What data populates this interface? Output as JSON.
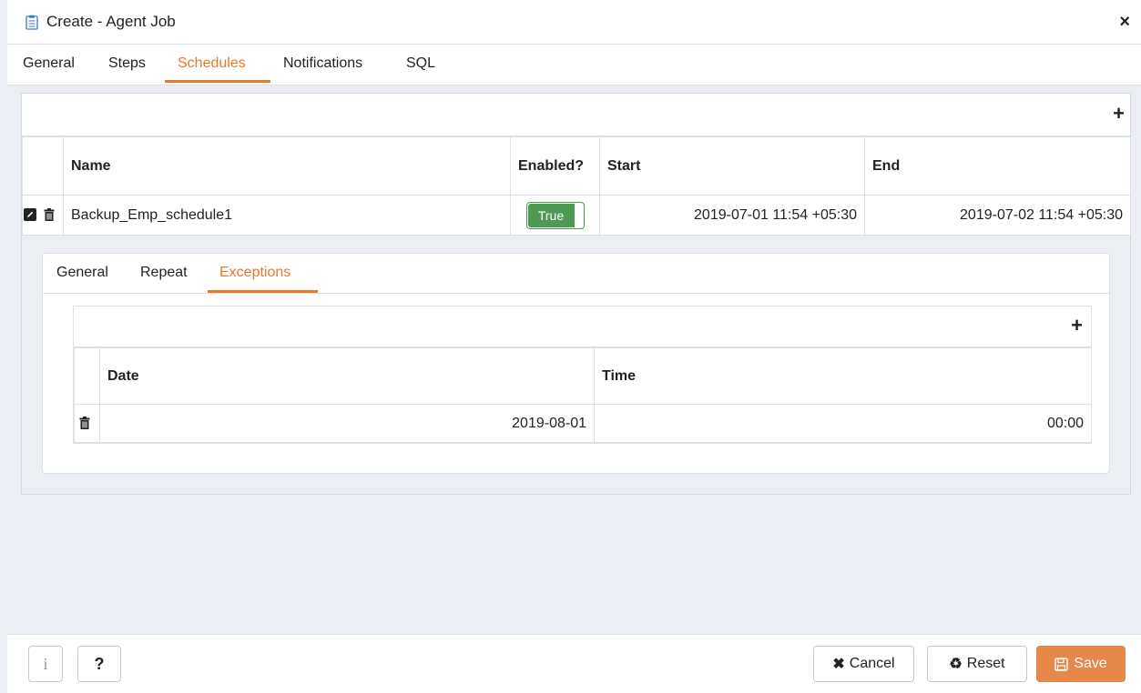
{
  "dialog": {
    "title": "Create - Agent Job",
    "close_icon": "×"
  },
  "tabs": [
    {
      "label": "General"
    },
    {
      "label": "Steps"
    },
    {
      "label": "Schedules"
    },
    {
      "label": "Notifications"
    },
    {
      "label": "SQL"
    }
  ],
  "active_tab": "Schedules",
  "schedules": {
    "add_icon": "+",
    "columns": [
      "Name",
      "Enabled?",
      "Start",
      "End"
    ],
    "rows": [
      {
        "name": "Backup_Emp_schedule1",
        "enabled": "True",
        "start": "2019-07-01 11:54 +05:30",
        "end": "2019-07-02 11:54 +05:30"
      }
    ]
  },
  "subtabs": [
    {
      "label": "General"
    },
    {
      "label": "Repeat"
    },
    {
      "label": "Exceptions"
    }
  ],
  "active_subtab": "Exceptions",
  "exceptions": {
    "add_icon": "+",
    "columns": [
      "Date",
      "Time"
    ],
    "rows": [
      {
        "date": "2019-08-01",
        "time": "00:00"
      }
    ]
  },
  "footer": {
    "info_label": "i",
    "help_label": "?",
    "cancel_label": "Cancel",
    "reset_label": "Reset",
    "save_label": "Save"
  },
  "colors": {
    "accent": "#e5792c",
    "toggle_on": "#4e9a52",
    "save_button": "#e5884a"
  }
}
